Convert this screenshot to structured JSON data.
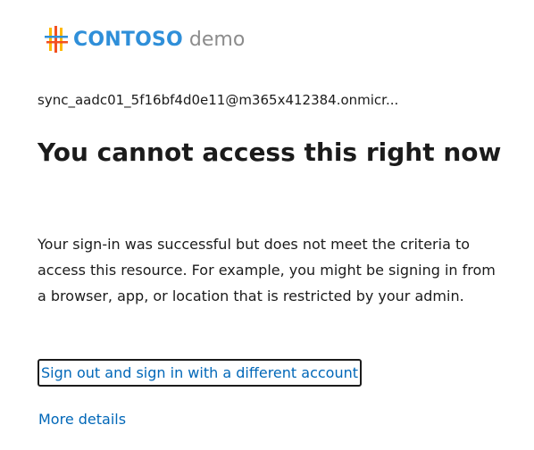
{
  "branding": {
    "brand_name": "CONTOSO",
    "brand_suffix": "demo",
    "logo_icon": "contoso-logo-icon",
    "brand_color": "#2f8fd9",
    "suffix_color": "#8c8c8c",
    "logo_stripe_colors": [
      "#f25022",
      "#ffb900",
      "#2f8fd9"
    ]
  },
  "account": {
    "identity": "sync_aadc01_5f16bf4d0e11@m365x412384.onmicr..."
  },
  "content": {
    "title": "You cannot access this right now",
    "message": "Your sign-in was successful but does not meet the criteria to access this resource. For example, you might be signing in from a browser, app, or location that is restricted by your admin."
  },
  "actions": {
    "sign_out_label": "Sign out and sign in with a different account",
    "more_details_label": "More details",
    "link_color": "#0067b8"
  }
}
